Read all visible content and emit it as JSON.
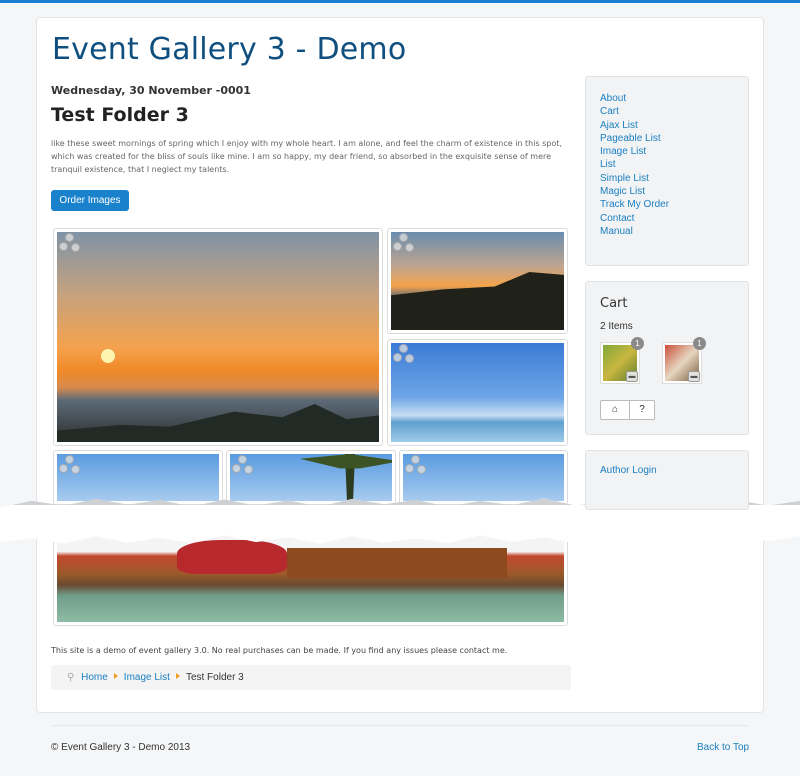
{
  "site": {
    "title": "Event Gallery 3 - Demo"
  },
  "folder": {
    "date": "Wednesday, 30 November -0001",
    "title": "Test Folder 3",
    "description": "like these sweet mornings of spring which I enjoy with my whole heart. I am alone, and feel the charm of existence in this spot, which was created for the bliss of souls like mine. I am so happy, my dear friend, so absorbed in the exquisite sense of mere tranquil existence, that I neglect my talents.",
    "order_button": "Order Images"
  },
  "gallery": {
    "images": [
      "sunset-sea",
      "sunset-coast",
      "beach",
      "beach-sky",
      "palm-tree",
      "sky",
      "boats-harbor"
    ],
    "share_icon": "share-icon"
  },
  "footnote": "This site is a demo of event gallery 3.0. No real purchases can be made. If you find any issues please contact me.",
  "breadcrumb": {
    "items": [
      "Home",
      "Image List",
      "Test Folder 3"
    ],
    "icon": "location-pin-icon"
  },
  "sidebar": {
    "menu": [
      "About",
      "Cart",
      "Ajax List",
      "Pageable List",
      "Image List",
      "List",
      "Simple List",
      "Magic List",
      "Track My Order",
      "Contact",
      "Manual"
    ],
    "cart": {
      "title": "Cart",
      "count_label": "2 Items",
      "items": [
        {
          "qty": "1",
          "icon": "trash-icon"
        },
        {
          "qty": "1",
          "icon": "trash-icon"
        }
      ],
      "cart_icon": "basket-icon",
      "help_label": "?"
    },
    "login": {
      "label": "Author Login"
    }
  },
  "footer": {
    "copyright": "© Event Gallery 3 - Demo 2013",
    "back_to_top": "Back to Top"
  },
  "colors": {
    "accent": "#1a81cc",
    "title": "#0f4f80",
    "link": "#1a7fc1",
    "breadcrumb_arrow": "#f0a022"
  }
}
